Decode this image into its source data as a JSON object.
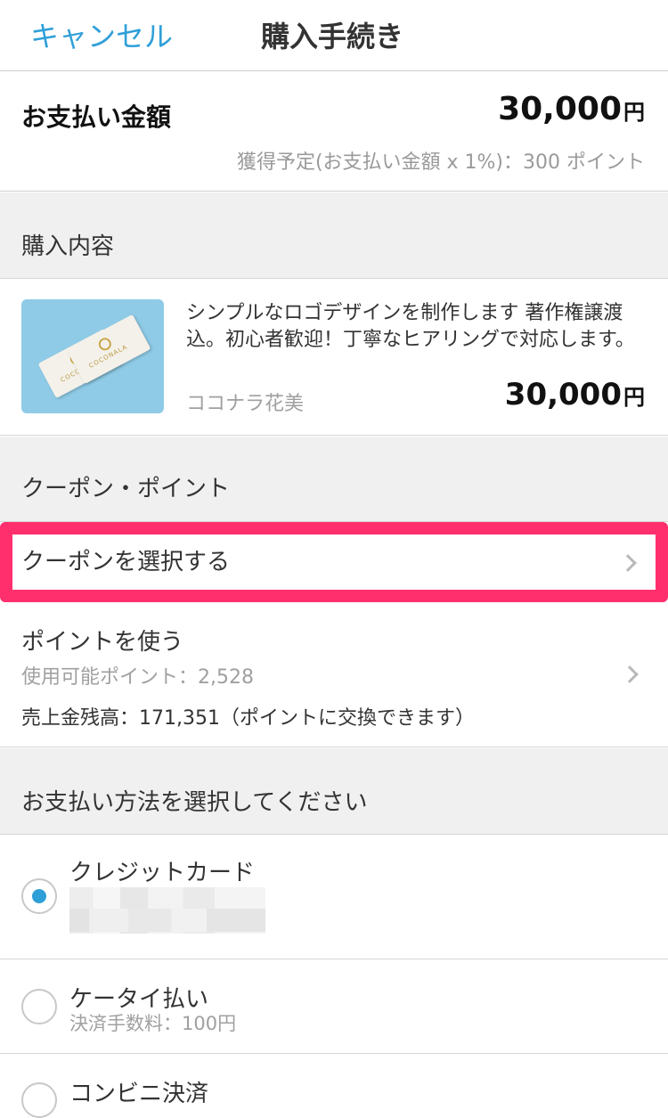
{
  "nav": {
    "cancel_label": "キャンセル",
    "title": "購入手続き"
  },
  "payment_amount": {
    "label": "お支払い金額",
    "value": "30,000",
    "currency": "円",
    "points_note": "獲得予定(お支払い金額 x 1%)：300 ポイント"
  },
  "purchase_contents": {
    "heading": "購入内容",
    "item": {
      "title": "シンプルなロゴデザインを制作します 著作権譲渡込。初心者歓迎！丁寧なヒアリングで対応します。",
      "seller": "ココナラ花美",
      "price": "30,000",
      "currency": "円",
      "thumbnail_logo_text": "COCONALA"
    }
  },
  "coupon_points": {
    "heading": "クーポン・ポイント",
    "coupon_select_label": "クーポンを選択する",
    "use_points_label": "ポイントを使う",
    "available_points": "使用可能ポイント：2,528",
    "sales_balance": "売上金残高：171,351（ポイントに交換できます）"
  },
  "payment_method": {
    "heading": "お支払い方法を選択してください",
    "options": [
      {
        "name": "クレジットカード",
        "selected": true
      },
      {
        "name": "ケータイ払い",
        "fee": "決済手数料：100円",
        "selected": false
      },
      {
        "name": "コンビニ決済",
        "selected": false
      }
    ]
  },
  "colors": {
    "accent": "#2f9fd8",
    "highlight_border": "#ff2f6e"
  }
}
